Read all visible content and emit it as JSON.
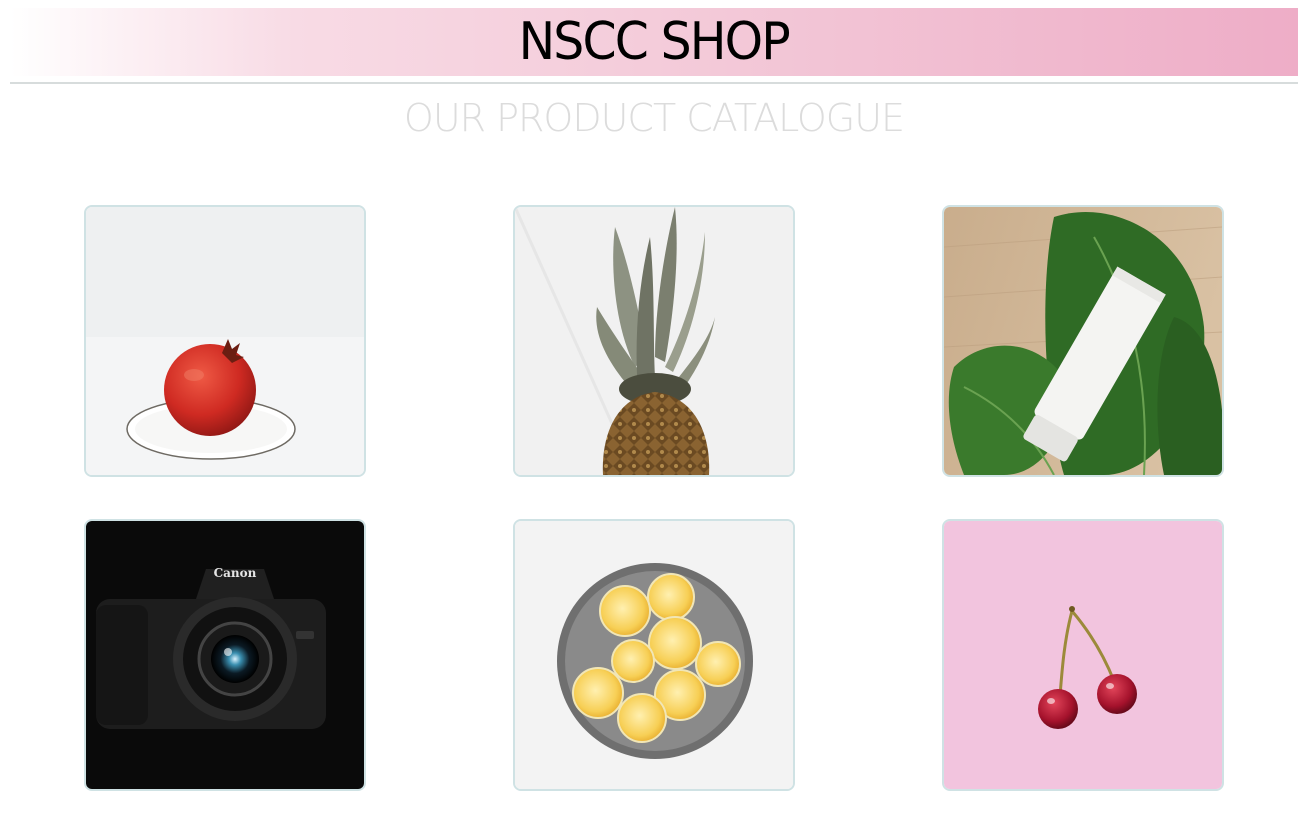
{
  "header": {
    "title": "NSCC SHOP",
    "subtitle": "OUR PRODUCT CATALOGUE"
  },
  "colors": {
    "header_gradient_end": "#eeadc7",
    "card_border": "#cfe2e4",
    "subtitle": "#dcdcdc"
  },
  "products": [
    {
      "name": "pomegranate",
      "icon": "pomegranate-image"
    },
    {
      "name": "pineapple",
      "icon": "pineapple-image"
    },
    {
      "name": "cream-tube",
      "icon": "cream-tube-image"
    },
    {
      "name": "camera",
      "icon": "camera-image",
      "brand_text": "Canon"
    },
    {
      "name": "lemons",
      "icon": "lemons-image"
    },
    {
      "name": "cherries",
      "icon": "cherries-image"
    }
  ]
}
